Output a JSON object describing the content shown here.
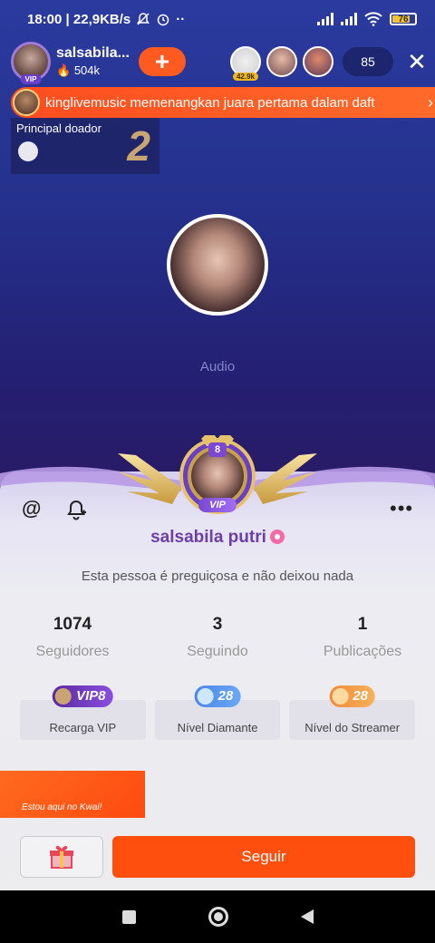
{
  "status_bar": {
    "time_speed": "18:00 | 22,9KB/s",
    "battery": "76"
  },
  "host": {
    "name": "salsabila...",
    "likes": "504k",
    "add_label": "+",
    "vip_tag": "VIP"
  },
  "viewers": {
    "first_tag": "42.9k",
    "count": "85",
    "close_label": "✕"
  },
  "marquee": {
    "text": "kinglivemusic memenangkan  juara pertama dalam daft",
    "chevron": "›"
  },
  "top_donor": {
    "label": "Principal doador",
    "rank": "2"
  },
  "room": {
    "mode_label": "Audio"
  },
  "profile": {
    "level": "8",
    "vip_label": "VIP",
    "name": "salsabila putri",
    "bio": "Esta pessoa é preguiçosa e não deixou nada",
    "stats": [
      {
        "value": "1074",
        "label": "Seguidores"
      },
      {
        "value": "3",
        "label": "Seguindo"
      },
      {
        "value": "1",
        "label": "Publicações"
      }
    ],
    "cards": [
      {
        "badge": "VIP8",
        "label": "Recarga VIP"
      },
      {
        "badge": "28",
        "label": "Nível Diamante"
      },
      {
        "badge": "28",
        "label": "Nível do Streamer"
      }
    ],
    "kwai_banner": "Estou aqui no Kwai!",
    "follow_label": "Seguir",
    "gift_icon": "gift-icon"
  }
}
